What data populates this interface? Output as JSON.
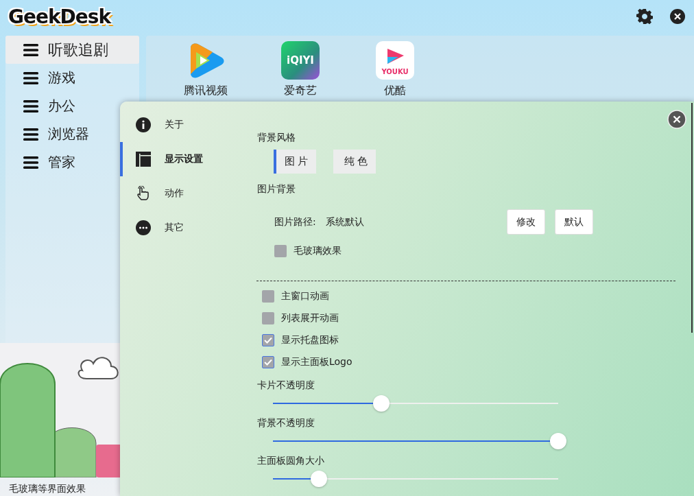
{
  "header": {
    "logo": "GeekDesk"
  },
  "menus": [
    {
      "label": "听歌追剧",
      "selected": true
    },
    {
      "label": "游戏",
      "selected": false
    },
    {
      "label": "办公",
      "selected": false
    },
    {
      "label": "浏览器",
      "selected": false
    },
    {
      "label": "管家",
      "selected": false
    }
  ],
  "apps": [
    {
      "name": "腾讯视频",
      "kind": "tencent"
    },
    {
      "name": "爱奇艺",
      "kind": "iqiyi",
      "icon_text": "iQIYI"
    },
    {
      "name": "优酷",
      "kind": "youku",
      "icon_text": "YOUKU"
    }
  ],
  "caption": "毛玻璃等界面效果",
  "settings": {
    "nav": [
      {
        "label": "关于",
        "selected": false
      },
      {
        "label": "显示设置",
        "selected": true
      },
      {
        "label": "动作",
        "selected": false
      },
      {
        "label": "其它",
        "selected": false
      }
    ],
    "background_style": {
      "title": "背景风格",
      "options": [
        {
          "label": "图 片",
          "selected": true
        },
        {
          "label": "纯 色",
          "selected": false
        }
      ]
    },
    "picture_background": {
      "title": "图片背景",
      "path_label": "图片路径:",
      "path_value": "系统默认",
      "buttons": [
        "修改",
        "默认"
      ],
      "blur": {
        "label": "毛玻璃效果",
        "checked": false
      }
    },
    "toggles": [
      {
        "label": "主窗口动画",
        "checked": false
      },
      {
        "label": "列表展开动画",
        "checked": false
      },
      {
        "label": "显示托盘图标",
        "checked": true
      },
      {
        "label": "显示主面板Logo",
        "checked": true
      }
    ],
    "sliders": [
      {
        "label": "卡片不透明度",
        "level": 0.38
      },
      {
        "label": "背景不透明度",
        "level": 1.0
      },
      {
        "label": "主面板圆角大小",
        "level": 0.16
      }
    ]
  }
}
